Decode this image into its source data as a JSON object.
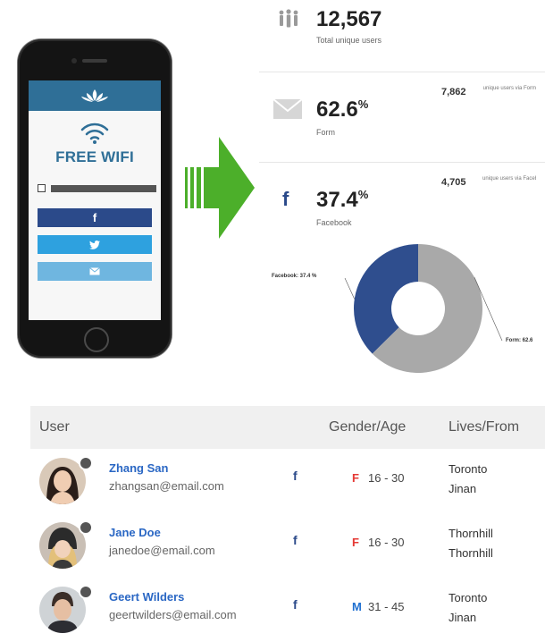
{
  "phone": {
    "title": "FREE WIFI",
    "buttons": {
      "facebook": "f",
      "twitter": "",
      "email": ""
    },
    "colors": {
      "header": "#2f6f97",
      "facebook": "#2b4a8a",
      "twitter": "#2ea1df",
      "email": "#6fb6e0"
    }
  },
  "arrow": {
    "color": "#4caf2a"
  },
  "stats": {
    "total": {
      "value": "12,567",
      "label": "Total unique users"
    },
    "form": {
      "value": "62.6",
      "unit": "%",
      "label": "Form",
      "count": "7,862",
      "desc": "unique users via Form"
    },
    "facebook": {
      "value": "37.4",
      "unit": "%",
      "label": "Facebook",
      "count": "4,705",
      "desc": "unique users via Facebook"
    }
  },
  "chart_data": {
    "type": "pie",
    "categories": [
      "Facebook",
      "Form"
    ],
    "values": [
      37.4,
      62.6
    ],
    "labels": [
      "Facebook: 37.4 %",
      "Form: 62.6"
    ],
    "colors": [
      "#2f4e8e",
      "#a9a9a9"
    ]
  },
  "table": {
    "headers": {
      "user": "User",
      "gender_age": "Gender/Age",
      "lives_from": "Lives/From"
    },
    "rows": [
      {
        "name": "Zhang San",
        "email": "zhangsan@email.com",
        "source": "f",
        "gender": "F",
        "age": "16 - 30",
        "lives": "Toronto",
        "from": "Jinan"
      },
      {
        "name": "Jane Doe",
        "email": "janedoe@email.com",
        "source": "f",
        "gender": "F",
        "age": "16 - 30",
        "lives": "Thornhill",
        "from": "Thornhill"
      },
      {
        "name": "Geert Wilders",
        "email": "geertwilders@email.com",
        "source": "f",
        "gender": "M",
        "age": "31 - 45",
        "lives": "Toronto",
        "from": "Jinan"
      }
    ]
  }
}
